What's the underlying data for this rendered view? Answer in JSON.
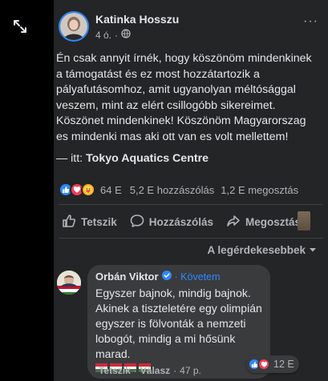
{
  "post": {
    "author": "Katinka Hosszu",
    "time": "4 ó.",
    "more": "···",
    "lines": [
      "Én csak annyit írnék, hogy köszönöm mindenkinek",
      "a támogatást és ez most hozzátartozik a",
      "pályafutásomhoz, amit ugyanolyan méltósággal",
      "veszem, mint az elért csillogóbb sikereimet.",
      "Köszönet mindenkinek! Köszönöm Magyarorszag",
      "es mindenki mas aki ott van es volt mellettem!"
    ],
    "location_prefix": "— itt:",
    "location": "Tokyo Aquatics Centre"
  },
  "stats": {
    "reactions": "64 E",
    "comments": "5,2 E hozzászólás",
    "shares": "1,2 E megosztás"
  },
  "actions": {
    "like": "Tetszik",
    "comment": "Hozzászólás",
    "share": "Megosztás"
  },
  "sort_label": "A legérdekesebbek",
  "comment": {
    "author": "Orbán Viktor",
    "follow": "· Követem",
    "lines": [
      "Egyszer bajnok, mindig bajnok.",
      "Akinek a tiszteletére egy olimpián",
      "egyszer is fölvonták a nemzeti",
      "lobogót, mindig a mi hősünk marad."
    ],
    "reactions": "12 E",
    "like": "Tetszik",
    "reply": "Válasz",
    "time": "47 p."
  },
  "colors": {
    "accent": "#2d88ff",
    "background": "#242526",
    "bubble": "#3a3b3c",
    "text": "#e4e6eb",
    "muted": "#b0b3b8"
  }
}
